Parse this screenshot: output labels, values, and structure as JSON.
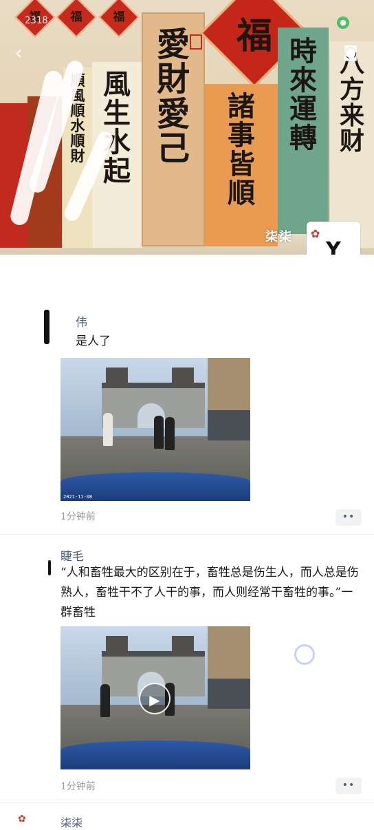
{
  "status_bar": {
    "badge": "2318"
  },
  "cover": {
    "diamonds": [
      "福",
      "福",
      "福"
    ],
    "fu_char": "福",
    "scrolls": {
      "shun_feng": [
        "順",
        "風",
        "順",
        "水",
        "順",
        "財"
      ],
      "feng_sheng": [
        "風",
        "生",
        "水",
        "起"
      ],
      "ai_cai": [
        "愛",
        "財",
        "愛",
        "己"
      ],
      "zhu_shi": [
        "諸",
        "事",
        "皆",
        "順"
      ],
      "shi_lai": [
        "時",
        "來",
        "運",
        "轉"
      ],
      "ba_fang": [
        "八",
        "方",
        "来",
        "财"
      ]
    },
    "author_name": "柒柒",
    "avatar_letter": "Y",
    "icons": {
      "back": "back-arrow-icon",
      "camera": "camera-icon",
      "mic": "microphone-icon"
    }
  },
  "posts": [
    {
      "author": "伟",
      "text": "是人了",
      "time": "1分钟前",
      "has_video": true,
      "video_stamp": "2021-11-08"
    },
    {
      "author": "睫毛",
      "text": "“人和畜牲最大的区别在于，畜牲总是伤生人，而人总是伤熟人，畜牲干不了人干的事，而人则经常干畜牲的事。”一群畜牲",
      "time": "1分钟前",
      "has_video": true,
      "video_stamp": ""
    }
  ],
  "next_post": {
    "author": "柒柒"
  },
  "more_label": "••"
}
